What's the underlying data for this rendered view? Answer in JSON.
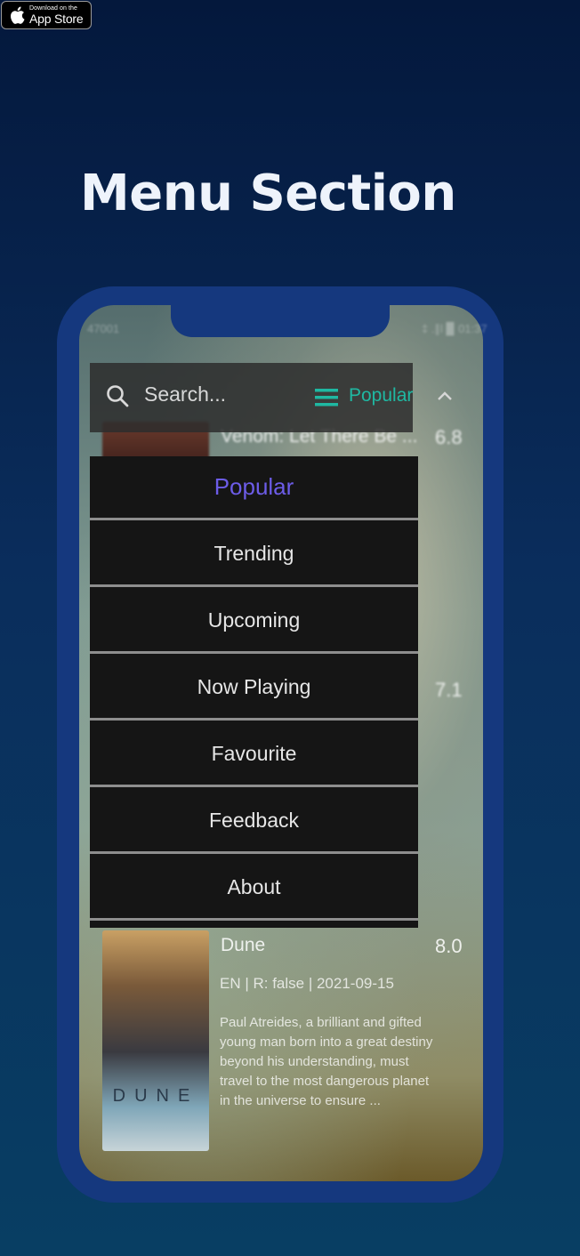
{
  "badge": {
    "small": "Download on the",
    "big": "App Store"
  },
  "hero": {
    "title": "Menu Section"
  },
  "status": {
    "left": "47001",
    "right": "‡ .∥l ▉ 01:37"
  },
  "search": {
    "placeholder": "Search...",
    "filter_label": "Popular"
  },
  "movies": [
    {
      "title": "Venom: Let There Be ...",
      "rating": "6.8"
    },
    {
      "title": "",
      "rating": "7.1"
    },
    {
      "title": "Dune",
      "rating": "8.0",
      "meta": "EN | R: false |  2021-09-15",
      "desc": "Paul Atreides, a brilliant and gifted young man born into a great destiny beyond his understanding, must travel to the most dangerous planet in the universe to ensure ..."
    }
  ],
  "menu": {
    "items": [
      {
        "label": "Popular",
        "active": true
      },
      {
        "label": "Trending"
      },
      {
        "label": "Upcoming"
      },
      {
        "label": "Now Playing"
      },
      {
        "label": "Favourite"
      },
      {
        "label": "Feedback"
      },
      {
        "label": "About"
      }
    ]
  },
  "colors": {
    "accent": "#6c5ce7",
    "filter": "#1fb8a2",
    "phone_frame": "#15387e"
  }
}
